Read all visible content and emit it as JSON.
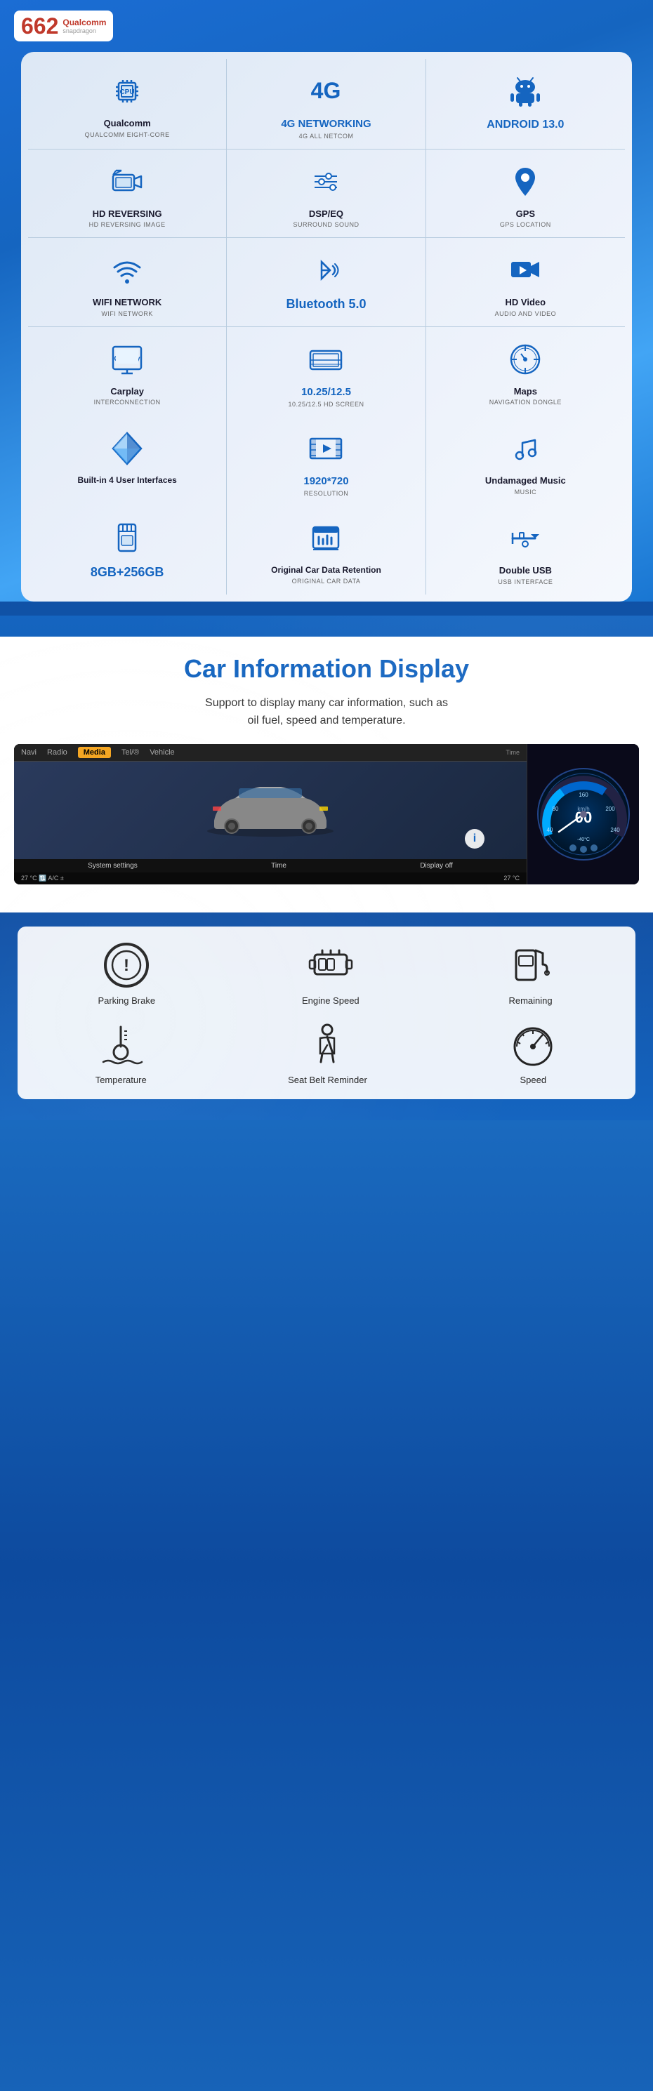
{
  "badge": {
    "number": "662",
    "brand": "Qualcomm",
    "sub": "snapdragon"
  },
  "features": [
    {
      "id": "qualcomm",
      "icon": "cpu",
      "title": "Qualcomm",
      "subtitle": "QUALCOMM EIGHT-CORE",
      "titleStyle": "normal"
    },
    {
      "id": "4g",
      "icon": "4g",
      "title": "4G NETWORKING",
      "subtitle": "4G ALL NETCOM",
      "titleStyle": "blue"
    },
    {
      "id": "android",
      "icon": "android",
      "title": "ANDROID 13.0",
      "subtitle": "",
      "titleStyle": "android"
    },
    {
      "id": "hd-reversing",
      "icon": "camera",
      "title": "HD REVERSING",
      "subtitle": "HD REVERSING IMAGE",
      "titleStyle": "normal"
    },
    {
      "id": "dsp-eq",
      "icon": "eq",
      "title": "DSP/EQ",
      "subtitle": "SURROUND SOUND",
      "titleStyle": "normal"
    },
    {
      "id": "gps",
      "icon": "pin",
      "title": "GPS",
      "subtitle": "GPS LOCATION",
      "titleStyle": "normal"
    },
    {
      "id": "wifi",
      "icon": "wifi",
      "title": "WIFI NETWORK",
      "subtitle": "WIFI NETWORK",
      "titleStyle": "normal"
    },
    {
      "id": "bluetooth",
      "icon": "bluetooth",
      "title": "Bluetooth 5.0",
      "subtitle": "",
      "titleStyle": "large-blue"
    },
    {
      "id": "hd-video",
      "icon": "video",
      "title": "HD Video",
      "subtitle": "AUDIO AND VIDEO",
      "titleStyle": "normal"
    },
    {
      "id": "carplay",
      "icon": "carplay",
      "title": "Carplay",
      "subtitle": "INTERCONNECTION",
      "titleStyle": "normal"
    },
    {
      "id": "screen",
      "icon": "screen",
      "title": "10.25/12.5",
      "subtitle": "10.25/12.5 HD SCREEN",
      "titleStyle": "blue"
    },
    {
      "id": "maps",
      "icon": "compass",
      "title": "Maps",
      "subtitle": "NAVIGATION DONGLE",
      "titleStyle": "normal"
    },
    {
      "id": "builtin4",
      "icon": "builtin4",
      "title": "Built-in 4 User Interfaces",
      "subtitle": "",
      "titleStyle": "normal"
    },
    {
      "id": "resolution",
      "icon": "film",
      "title": "1920*720",
      "subtitle": "Resolution",
      "titleStyle": "blue"
    },
    {
      "id": "music",
      "icon": "music",
      "title": "Undamaged Music",
      "subtitle": "MUSIC",
      "titleStyle": "normal"
    },
    {
      "id": "storage",
      "icon": "sd",
      "title": "8GB+256GB",
      "subtitle": "",
      "titleStyle": "large-blue"
    },
    {
      "id": "cardata",
      "icon": "cardata",
      "title": "Original Car Data Retention",
      "subtitle": "ORIGINAL CAR DATA",
      "titleStyle": "normal"
    },
    {
      "id": "usb",
      "icon": "usb",
      "title": "Double USB",
      "subtitle": "USB INTERFACE",
      "titleStyle": "normal"
    }
  ],
  "carInfo": {
    "title": "Car Information Display",
    "description": "Support to display many car information, such as\noil fuel, speed and temperature.",
    "dashboard": {
      "navItems": [
        "Navi",
        "Radio",
        "Media",
        "Tel/®",
        "Vehicle"
      ],
      "activeNav": "Media",
      "bottomItems": [
        "System settings",
        "Time",
        "Display off"
      ],
      "tempLeft": "27 °C",
      "tempRight": "27 °C"
    }
  },
  "infoIcons": [
    {
      "id": "parking-brake",
      "icon": "parking-brake",
      "label": "Parking Brake"
    },
    {
      "id": "engine-speed",
      "icon": "engine",
      "label": "Engine Speed"
    },
    {
      "id": "remaining",
      "icon": "fuel",
      "label": "Remaining"
    },
    {
      "id": "temperature",
      "icon": "temperature",
      "label": "Temperature"
    },
    {
      "id": "seatbelt",
      "icon": "seatbelt",
      "label": "Seat Belt Reminder"
    },
    {
      "id": "speed",
      "icon": "speedometer",
      "label": "Speed"
    }
  ]
}
